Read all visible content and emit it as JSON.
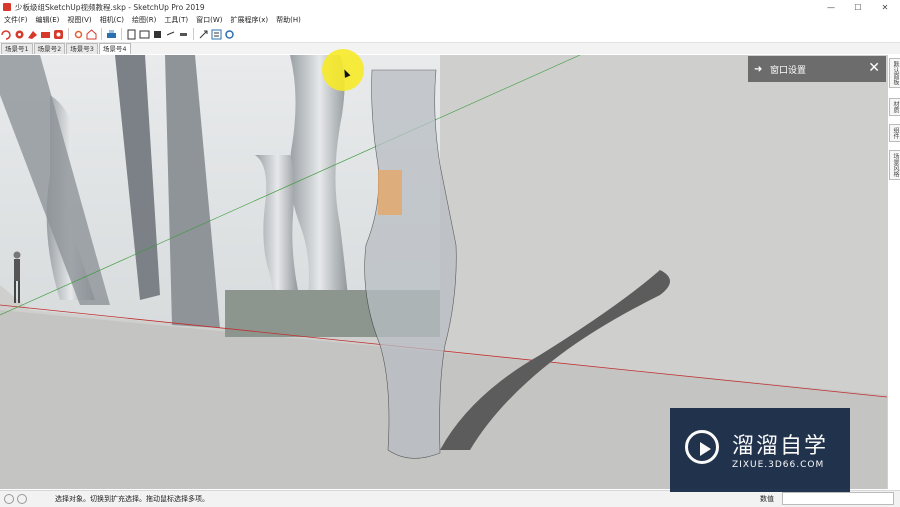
{
  "window": {
    "title": "少板级组SketchUp视频教程.skp - SketchUp Pro 2019",
    "controls": {
      "minimize": "—",
      "maximize": "☐",
      "close": "✕"
    }
  },
  "menu": {
    "items": [
      "文件(F)",
      "编辑(E)",
      "视图(V)",
      "相机(C)",
      "绘图(R)",
      "工具(T)",
      "窗口(W)",
      "扩展程序(x)",
      "帮助(H)"
    ]
  },
  "toolbar": {
    "icons": [
      "select-tool-icon",
      "component-icon",
      "paint-icon",
      "eraser-icon",
      "record-icon",
      "sun-icon",
      "house-icon",
      "printer-icon",
      "section-plane-icon",
      "section-cut-icon",
      "section-fill-icon",
      "section-display-icon",
      "section-lines-icon",
      "dimension-icon",
      "outliner-icon",
      "settings-icon"
    ]
  },
  "scenes": {
    "tabs": [
      "场景号1",
      "场景号2",
      "场景号3",
      "场景号4"
    ],
    "active_index": 3
  },
  "panel": {
    "title": "窗口设置",
    "close": "✕"
  },
  "right_tray": {
    "tabs": [
      "默认面板",
      "材质",
      "组件",
      "场景风格"
    ]
  },
  "status": {
    "message": "选择对象。切换到扩充选择。拖动鼠标选择多项。",
    "measurements_label": "数值"
  },
  "watermark": {
    "title": "溜溜自学",
    "url": "ZIXUE.3D66.COM"
  },
  "colors": {
    "accent_red": "#d6392b",
    "viewport_bg": "#cfcfcf",
    "panel_header": "#6c6c6c",
    "watermark_bg": "#152745",
    "cursor_highlight": "#f7ea28"
  }
}
